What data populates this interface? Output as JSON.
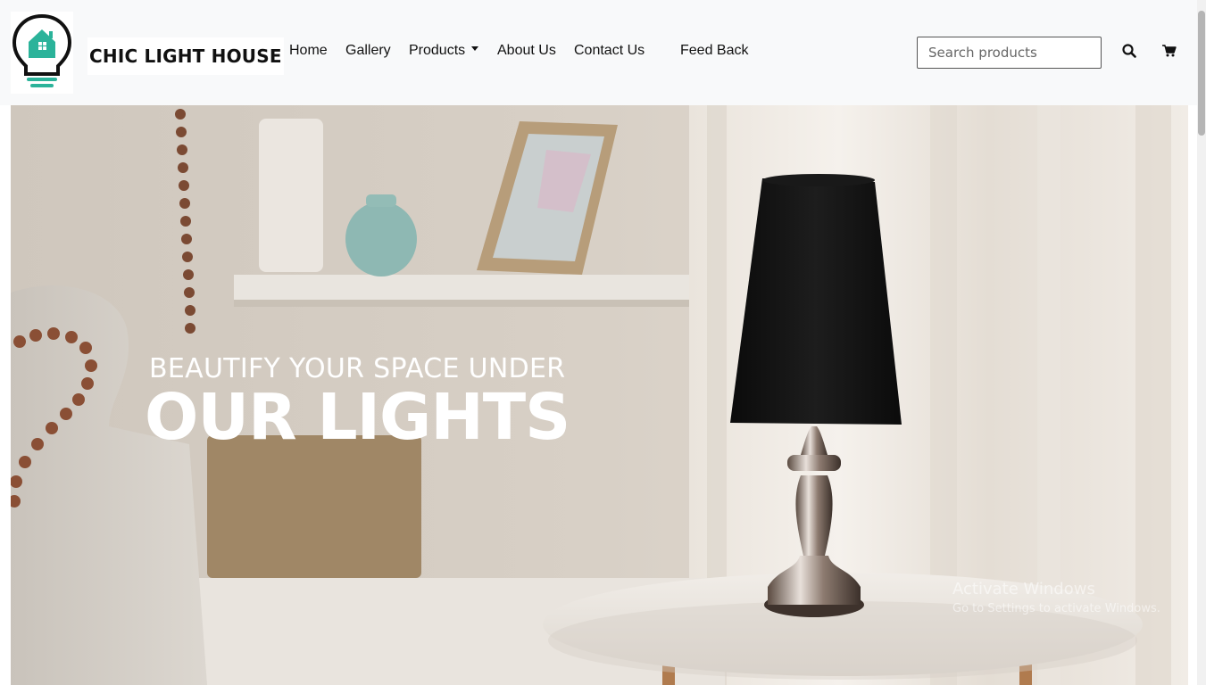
{
  "brand": {
    "name": "CHIC LIGHT HOUSE",
    "logo_icon": "lightbulb-house-logo"
  },
  "nav": {
    "home": "Home",
    "gallery": "Gallery",
    "products": "Products",
    "about": "About Us",
    "contact": "Contact Us",
    "feedback": "Feed Back"
  },
  "search": {
    "placeholder": "Search products",
    "icon": "search-icon"
  },
  "cart": {
    "icon": "cart-icon"
  },
  "hero": {
    "line1": "BEAUTIFY YOUR SPACE UNDER",
    "line2": "OUR LIGHTS"
  },
  "watermark": {
    "title": "Activate Windows",
    "subtitle": "Go to Settings to activate Windows."
  },
  "colors": {
    "accent": "#2bb39a",
    "navbar_bg": "#f8f9fa",
    "text": "#111111"
  }
}
